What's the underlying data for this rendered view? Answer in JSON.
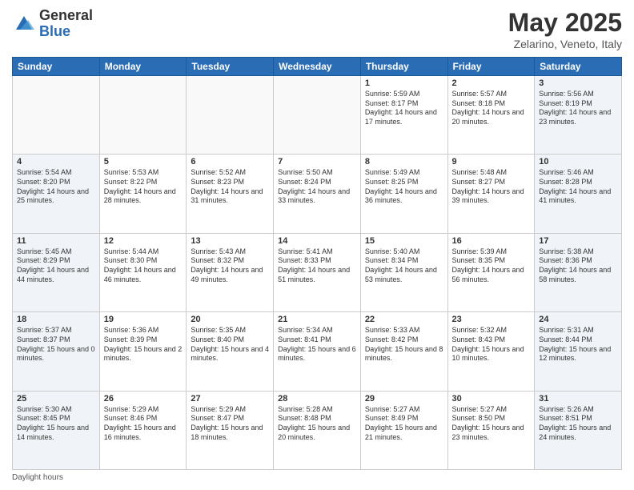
{
  "header": {
    "logo": {
      "general": "General",
      "blue": "Blue"
    },
    "title": "May 2025",
    "subtitle": "Zelarino, Veneto, Italy"
  },
  "weekdays": [
    "Sunday",
    "Monday",
    "Tuesday",
    "Wednesday",
    "Thursday",
    "Friday",
    "Saturday"
  ],
  "weeks": [
    [
      {
        "day": "",
        "info": ""
      },
      {
        "day": "",
        "info": ""
      },
      {
        "day": "",
        "info": ""
      },
      {
        "day": "",
        "info": ""
      },
      {
        "day": "1",
        "info": "Sunrise: 5:59 AM\nSunset: 8:17 PM\nDaylight: 14 hours\nand 17 minutes."
      },
      {
        "day": "2",
        "info": "Sunrise: 5:57 AM\nSunset: 8:18 PM\nDaylight: 14 hours\nand 20 minutes."
      },
      {
        "day": "3",
        "info": "Sunrise: 5:56 AM\nSunset: 8:19 PM\nDaylight: 14 hours\nand 23 minutes."
      }
    ],
    [
      {
        "day": "4",
        "info": "Sunrise: 5:54 AM\nSunset: 8:20 PM\nDaylight: 14 hours\nand 25 minutes."
      },
      {
        "day": "5",
        "info": "Sunrise: 5:53 AM\nSunset: 8:22 PM\nDaylight: 14 hours\nand 28 minutes."
      },
      {
        "day": "6",
        "info": "Sunrise: 5:52 AM\nSunset: 8:23 PM\nDaylight: 14 hours\nand 31 minutes."
      },
      {
        "day": "7",
        "info": "Sunrise: 5:50 AM\nSunset: 8:24 PM\nDaylight: 14 hours\nand 33 minutes."
      },
      {
        "day": "8",
        "info": "Sunrise: 5:49 AM\nSunset: 8:25 PM\nDaylight: 14 hours\nand 36 minutes."
      },
      {
        "day": "9",
        "info": "Sunrise: 5:48 AM\nSunset: 8:27 PM\nDaylight: 14 hours\nand 39 minutes."
      },
      {
        "day": "10",
        "info": "Sunrise: 5:46 AM\nSunset: 8:28 PM\nDaylight: 14 hours\nand 41 minutes."
      }
    ],
    [
      {
        "day": "11",
        "info": "Sunrise: 5:45 AM\nSunset: 8:29 PM\nDaylight: 14 hours\nand 44 minutes."
      },
      {
        "day": "12",
        "info": "Sunrise: 5:44 AM\nSunset: 8:30 PM\nDaylight: 14 hours\nand 46 minutes."
      },
      {
        "day": "13",
        "info": "Sunrise: 5:43 AM\nSunset: 8:32 PM\nDaylight: 14 hours\nand 49 minutes."
      },
      {
        "day": "14",
        "info": "Sunrise: 5:41 AM\nSunset: 8:33 PM\nDaylight: 14 hours\nand 51 minutes."
      },
      {
        "day": "15",
        "info": "Sunrise: 5:40 AM\nSunset: 8:34 PM\nDaylight: 14 hours\nand 53 minutes."
      },
      {
        "day": "16",
        "info": "Sunrise: 5:39 AM\nSunset: 8:35 PM\nDaylight: 14 hours\nand 56 minutes."
      },
      {
        "day": "17",
        "info": "Sunrise: 5:38 AM\nSunset: 8:36 PM\nDaylight: 14 hours\nand 58 minutes."
      }
    ],
    [
      {
        "day": "18",
        "info": "Sunrise: 5:37 AM\nSunset: 8:37 PM\nDaylight: 15 hours\nand 0 minutes."
      },
      {
        "day": "19",
        "info": "Sunrise: 5:36 AM\nSunset: 8:39 PM\nDaylight: 15 hours\nand 2 minutes."
      },
      {
        "day": "20",
        "info": "Sunrise: 5:35 AM\nSunset: 8:40 PM\nDaylight: 15 hours\nand 4 minutes."
      },
      {
        "day": "21",
        "info": "Sunrise: 5:34 AM\nSunset: 8:41 PM\nDaylight: 15 hours\nand 6 minutes."
      },
      {
        "day": "22",
        "info": "Sunrise: 5:33 AM\nSunset: 8:42 PM\nDaylight: 15 hours\nand 8 minutes."
      },
      {
        "day": "23",
        "info": "Sunrise: 5:32 AM\nSunset: 8:43 PM\nDaylight: 15 hours\nand 10 minutes."
      },
      {
        "day": "24",
        "info": "Sunrise: 5:31 AM\nSunset: 8:44 PM\nDaylight: 15 hours\nand 12 minutes."
      }
    ],
    [
      {
        "day": "25",
        "info": "Sunrise: 5:30 AM\nSunset: 8:45 PM\nDaylight: 15 hours\nand 14 minutes."
      },
      {
        "day": "26",
        "info": "Sunrise: 5:29 AM\nSunset: 8:46 PM\nDaylight: 15 hours\nand 16 minutes."
      },
      {
        "day": "27",
        "info": "Sunrise: 5:29 AM\nSunset: 8:47 PM\nDaylight: 15 hours\nand 18 minutes."
      },
      {
        "day": "28",
        "info": "Sunrise: 5:28 AM\nSunset: 8:48 PM\nDaylight: 15 hours\nand 20 minutes."
      },
      {
        "day": "29",
        "info": "Sunrise: 5:27 AM\nSunset: 8:49 PM\nDaylight: 15 hours\nand 21 minutes."
      },
      {
        "day": "30",
        "info": "Sunrise: 5:27 AM\nSunset: 8:50 PM\nDaylight: 15 hours\nand 23 minutes."
      },
      {
        "day": "31",
        "info": "Sunrise: 5:26 AM\nSunset: 8:51 PM\nDaylight: 15 hours\nand 24 minutes."
      }
    ]
  ],
  "footer": {
    "text": "Daylight hours"
  }
}
